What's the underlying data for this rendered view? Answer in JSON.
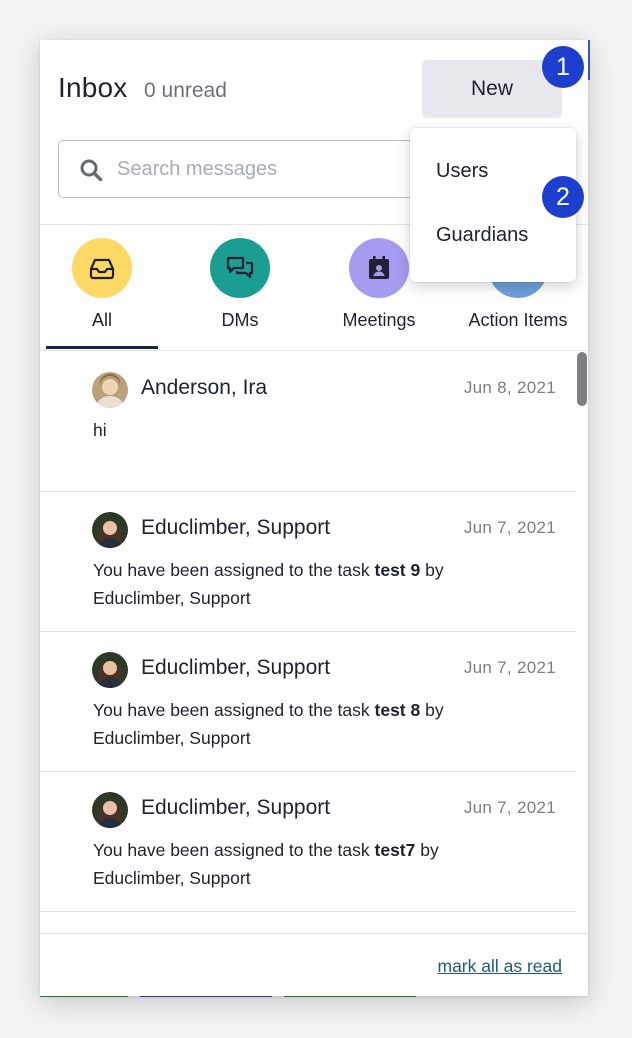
{
  "header": {
    "title": "Inbox",
    "unread": "0 unread",
    "new_label": "New"
  },
  "search": {
    "placeholder": "Search messages"
  },
  "tabs": [
    {
      "label": "All",
      "icon": "inbox-tray-icon",
      "color": "#ffd966",
      "active": true
    },
    {
      "label": "DMs",
      "icon": "chat-bubbles-icon",
      "color": "#1a9e92"
    },
    {
      "label": "Meetings",
      "icon": "calendar-person-icon",
      "color": "#a59bf0"
    },
    {
      "label": "Action Items",
      "icon": "action-items-icon",
      "color": "#6f9fde"
    }
  ],
  "messages": [
    {
      "sender": "Anderson, Ira",
      "date": "Jun 8, 2021",
      "body_pre": "hi",
      "body_bold": "",
      "body_post": ""
    },
    {
      "sender": "Educlimber, Support",
      "date": "Jun 7, 2021",
      "body_pre": "You have been assigned to the task ",
      "body_bold": "test 9",
      "body_post": " by Educlimber, Support"
    },
    {
      "sender": "Educlimber, Support",
      "date": "Jun 7, 2021",
      "body_pre": "You have been assigned to the task ",
      "body_bold": "test 8",
      "body_post": " by Educlimber, Support"
    },
    {
      "sender": "Educlimber, Support",
      "date": "Jun 7, 2021",
      "body_pre": "You have been assigned to the task ",
      "body_bold": "test7",
      "body_post": " by Educlimber, Support"
    }
  ],
  "footer": {
    "mark_all_read": "mark all as read"
  },
  "dropdown": {
    "items": [
      "Users",
      "Guardians"
    ]
  },
  "badges": [
    "1",
    "2"
  ],
  "colors": {
    "accent_dark": "#1b2447",
    "badge_blue": "#1d3fd0",
    "link": "#1e5b73"
  }
}
